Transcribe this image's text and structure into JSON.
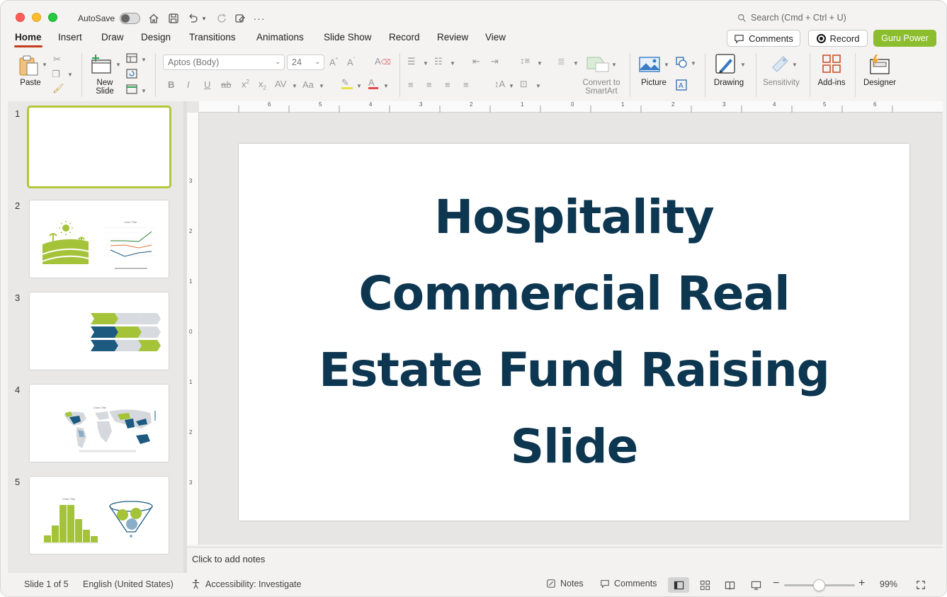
{
  "titlebar": {
    "autosave_label": "AutoSave",
    "search_placeholder": "Search (Cmd + Ctrl + U)"
  },
  "tabs": [
    {
      "label": "Home"
    },
    {
      "label": "Insert"
    },
    {
      "label": "Draw"
    },
    {
      "label": "Design"
    },
    {
      "label": "Transitions"
    },
    {
      "label": "Animations"
    },
    {
      "label": "Slide Show"
    },
    {
      "label": "Record"
    },
    {
      "label": "Review"
    },
    {
      "label": "View"
    }
  ],
  "header_buttons": {
    "comments": "Comments",
    "record": "Record",
    "guru": "Guru Power"
  },
  "ribbon": {
    "paste": "Paste",
    "new_slide_1": "New",
    "new_slide_2": "Slide",
    "font_name": "Aptos (Body)",
    "font_size": "24",
    "smartart_1": "Convert to",
    "smartart_2": "SmartArt",
    "picture": "Picture",
    "drawing": "Drawing",
    "sensitivity": "Sensitivity",
    "addins": "Add-ins",
    "designer": "Designer"
  },
  "thumbnails": [
    {
      "num": "1"
    },
    {
      "num": "2"
    },
    {
      "num": "3"
    },
    {
      "num": "4"
    },
    {
      "num": "5"
    }
  ],
  "thumb2_chart_title": "Chart Title",
  "thumb4_chart_title": "Chart Title",
  "thumb5_chart_title": "Chart Title",
  "slide": {
    "title": "Hospitality Commercial Real Estate Fund Raising Slide"
  },
  "rulers": {
    "h": [
      "6",
      "5",
      "4",
      "3",
      "2",
      "1",
      "0",
      "1",
      "2",
      "3",
      "4",
      "5",
      "6"
    ],
    "v": [
      "3",
      "2",
      "1",
      "0",
      "1",
      "2",
      "3"
    ]
  },
  "notes": {
    "placeholder": "Click to add notes"
  },
  "status": {
    "slide_count": "Slide 1 of 5",
    "language": "English (United States)",
    "accessibility": "Accessibility: Investigate",
    "notes": "Notes",
    "comments": "Comments",
    "zoom": "99%"
  },
  "colors": {
    "accent": "#c43e1c",
    "guru": "#8bbd2e",
    "title": "#0d3650",
    "thumb_green": "#a4c339",
    "thumb_blue": "#1d5a80"
  }
}
